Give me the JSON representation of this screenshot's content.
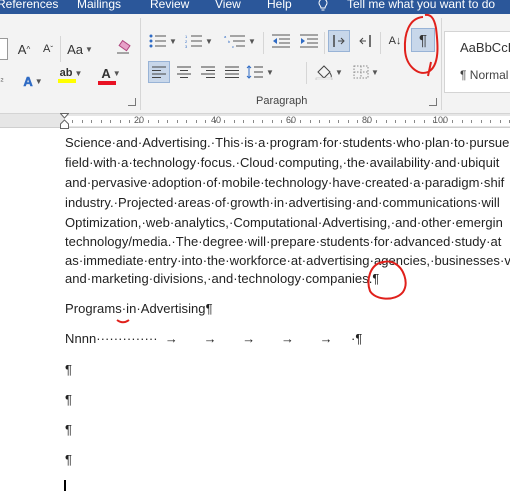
{
  "tabs": [
    "References",
    "Mailings",
    "Review",
    "View",
    "Help"
  ],
  "tell_me": "Tell me what you want to do",
  "font_buttons": {
    "grow": "A",
    "shrink": "A",
    "change_case": "Aa",
    "text_effects": "A",
    "highlight": "ab",
    "font_color": "A"
  },
  "paragraph_group_label": "Paragraph",
  "sort_label": "A↓",
  "show_marks_label": "¶",
  "styles": {
    "preview": "AaBbCcD",
    "current": "¶ Normal"
  },
  "ruler_numbers": [
    "20",
    "40",
    "60",
    "80",
    "100"
  ],
  "document_lines": [
    "Science·and·Advertising.·This·is·a·program·for·students·who·plan·to·pursue",
    "field·with·a·technology·focus.·Cloud·computing,·the·availability·and·ubiquit",
    "and·pervasive·adoption·of·mobile·technology·have·created·a·paradigm·shif",
    "industry.·Projected·areas·of·growth·in·advertising·and·communications·will",
    "Optimization,·web·analytics,·Computational·Advertising,·and·other·emergin",
    "technology/media.·The·degree·will·prepare·students·for·advanced·study·at",
    "as·immediate·entry·into·the·workforce·at·advertising·agencies,·businesses·v",
    "and·marketing·divisions,·and·technology·companies.¶"
  ],
  "heading_line": "Programs·in·Advertising¶",
  "tab_line": "Nnnn··············  →       →       →       →       →     ·¶",
  "empty_paragraphs": [
    "¶",
    "¶",
    "¶",
    "¶"
  ],
  "colors": {
    "ribbon_blue": "#2b579a",
    "highlight_yellow": "#ffff00",
    "font_red": "#e81123",
    "annotation_red": "#e0201b"
  }
}
